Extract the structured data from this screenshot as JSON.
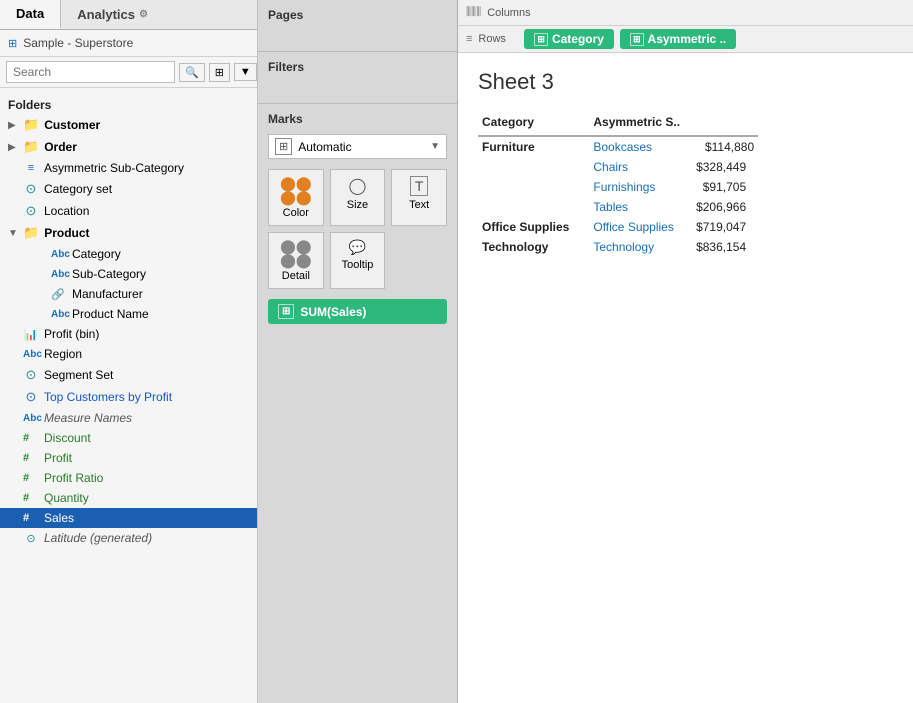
{
  "tabs": [
    {
      "id": "data",
      "label": "Data",
      "active": true
    },
    {
      "id": "analytics",
      "label": "Analytics",
      "active": false
    }
  ],
  "source": {
    "icon": "⊞",
    "label": "Sample - Superstore"
  },
  "search": {
    "placeholder": "Search",
    "placeholder_icon": "🔍"
  },
  "folders_label": "Folders",
  "field_groups": [
    {
      "type": "folder",
      "expand": "▶",
      "icon": "📁",
      "label": "Customer",
      "icon_type": "folder"
    },
    {
      "type": "folder",
      "expand": "▶",
      "icon": "📁",
      "label": "Order",
      "icon_type": "folder"
    },
    {
      "type": "item",
      "icon": "≡",
      "label": "Asymmetric Sub-Category",
      "icon_type": "set"
    },
    {
      "type": "item",
      "icon": "⊙",
      "label": "Category set",
      "icon_type": "set-teal"
    },
    {
      "type": "item",
      "icon": "⊙",
      "label": "Location",
      "icon_type": "set-teal"
    },
    {
      "type": "folder",
      "expand": "▼",
      "icon": "📁",
      "label": "Product",
      "icon_type": "folder-open",
      "children": [
        {
          "icon": "Abc",
          "label": "Category"
        },
        {
          "icon": "Abc",
          "label": "Sub-Category"
        },
        {
          "icon": "🔗",
          "label": "Manufacturer"
        },
        {
          "icon": "Abc",
          "label": "Product Name"
        }
      ]
    },
    {
      "type": "item",
      "icon": "📊",
      "label": "Profit (bin)",
      "icon_type": "bin"
    },
    {
      "type": "item",
      "icon": "Abc",
      "label": "Region",
      "icon_type": "abc"
    },
    {
      "type": "item",
      "icon": "⊙",
      "label": "Segment Set",
      "icon_type": "set-teal"
    },
    {
      "type": "item",
      "icon": "⊙",
      "label": "Top Customers by Profit",
      "icon_type": "set-blue",
      "color": "blue"
    },
    {
      "type": "item",
      "icon": "Abc",
      "label": "Measure Names",
      "icon_type": "abc",
      "italic": true
    },
    {
      "type": "item",
      "icon": "#",
      "label": "Discount",
      "icon_type": "measure"
    },
    {
      "type": "item",
      "icon": "#",
      "label": "Profit",
      "icon_type": "measure"
    },
    {
      "type": "item",
      "icon": "#",
      "label": "Profit Ratio",
      "icon_type": "measure"
    },
    {
      "type": "item",
      "icon": "#",
      "label": "Quantity",
      "icon_type": "measure"
    },
    {
      "type": "item",
      "icon": "#",
      "label": "Sales",
      "icon_type": "measure",
      "selected": true
    },
    {
      "type": "item",
      "icon": "⊙",
      "label": "Latitude (generated)",
      "icon_type": "measure-italic",
      "italic": true
    }
  ],
  "pages_label": "Pages",
  "filters_label": "Filters",
  "marks_label": "Marks",
  "marks_dropdown": "Automatic",
  "marks_buttons": [
    {
      "id": "color",
      "icon": "●●\n●●",
      "label": "Color"
    },
    {
      "id": "size",
      "icon": "◯",
      "label": "Size"
    },
    {
      "id": "text",
      "icon": "T",
      "label": "Text",
      "active": true
    },
    {
      "id": "detail",
      "icon": "●●\n●●",
      "label": "Detail"
    },
    {
      "id": "tooltip",
      "icon": "💬",
      "label": "Tooltip"
    }
  ],
  "sum_sales": "SUM(Sales)",
  "columns_label": "Columns",
  "rows_label": "Rows",
  "rows_pills": [
    {
      "label": "Category",
      "color": "teal"
    },
    {
      "label": "Asymmetric ..",
      "color": "teal"
    }
  ],
  "sheet_title": "Sheet 3",
  "table_headers": [
    "Category",
    "Asymmetric S.."
  ],
  "table_data": [
    {
      "category": "Furniture",
      "is_category_row": true,
      "sub_rows": [
        {
          "sub": "Bookcases",
          "value": "$114,880"
        },
        {
          "sub": "Chairs",
          "value": "$328,449"
        },
        {
          "sub": "Furnishings",
          "value": "$91,705"
        },
        {
          "sub": "Tables",
          "value": "$206,966"
        }
      ]
    },
    {
      "category": "Office Supplies",
      "is_category_row": true,
      "sub_rows": [
        {
          "sub": "Office Supplies",
          "value": "$719,047"
        }
      ]
    },
    {
      "category": "Technology",
      "is_category_row": true,
      "sub_rows": [
        {
          "sub": "Technology",
          "value": "$836,154"
        }
      ]
    }
  ]
}
